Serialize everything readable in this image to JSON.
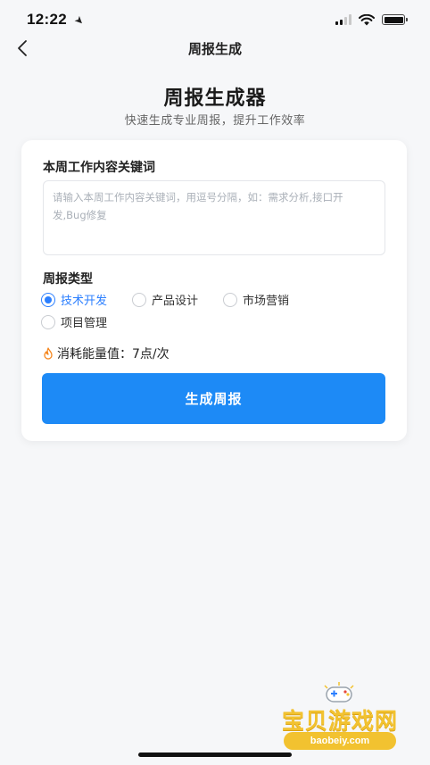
{
  "status_bar": {
    "time": "12:22",
    "location_icon": "location-arrow-icon",
    "signal_icon": "cellular-signal-icon",
    "wifi_icon": "wifi-icon",
    "battery_icon": "battery-icon"
  },
  "nav": {
    "back_icon": "chevron-left-icon",
    "title": "周报生成"
  },
  "hero": {
    "title": "周报生成器",
    "subtitle": "快速生成专业周报，提升工作效率"
  },
  "form": {
    "keywords_label": "本周工作内容关键词",
    "keywords_value": "",
    "keywords_placeholder": "请输入本周工作内容关键词，用逗号分隔，如：需求分析,接口开发,Bug修复",
    "type_label": "周报类型",
    "types": [
      {
        "label": "技术开发",
        "selected": true
      },
      {
        "label": "产品设计",
        "selected": false
      },
      {
        "label": "市场营销",
        "selected": false
      },
      {
        "label": "项目管理",
        "selected": false
      }
    ],
    "cost_icon": "fire-icon",
    "cost_text": "消耗能量值：7点/次",
    "submit_label": "生成周报"
  },
  "watermark": {
    "text": "宝贝游戏网",
    "url": "baobeiy.com"
  },
  "colors": {
    "accent": "#1d8af6",
    "radio_selected": "#2b7fff",
    "background": "#f6f7f9",
    "card": "#ffffff"
  }
}
